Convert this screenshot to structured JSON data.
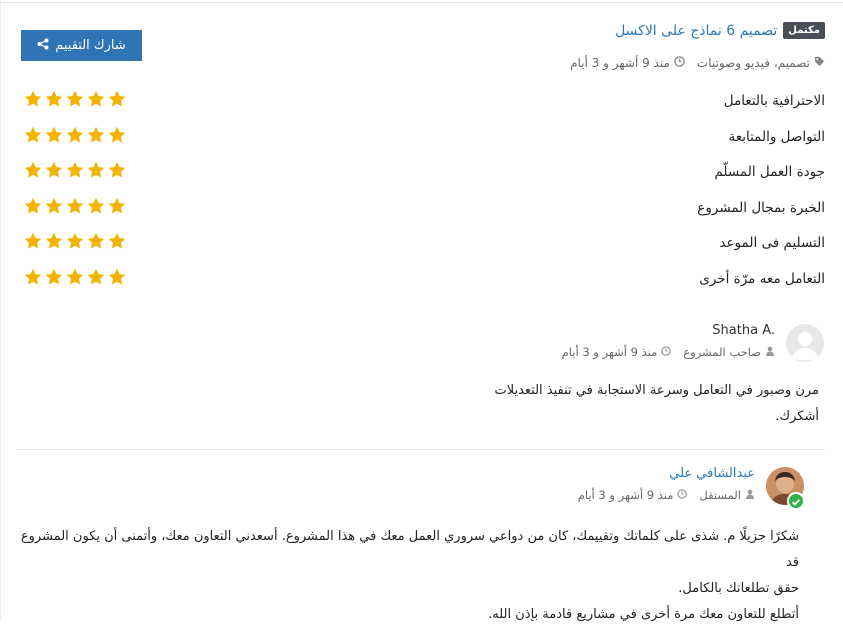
{
  "project": {
    "badge": "مكتمل",
    "title": "تصميم 6 نماذج على الاكسل",
    "category": "تصميم، فيديو وصوتيات",
    "time": "منذ 9 أشهر و 3 أيام"
  },
  "share": {
    "label": "شارك التقييم"
  },
  "criteria": [
    {
      "label": "الاحترافية بالتعامل",
      "rating": 5
    },
    {
      "label": "التواصل والمتابعة",
      "rating": 5
    },
    {
      "label": "جودة العمل المسلّم",
      "rating": 5
    },
    {
      "label": "الخبرة بمجال المشروع",
      "rating": 5
    },
    {
      "label": "التسليم فى الموعد",
      "rating": 5
    },
    {
      "label": "التعامل معه مرّة أخرى",
      "rating": 5
    }
  ],
  "review": {
    "name": "Shatha A.",
    "role": "صاحب المشروع",
    "time": "منذ 9 أشهر و 3 أيام",
    "lines": [
      "مرن وصبور في التعامل وسرعة الاستجابة في تنفيذ التعديلات",
      "أشكرك."
    ]
  },
  "reply": {
    "name": "عبدالشافي علي",
    "role": "المستقل",
    "time": "منذ 9 أشهر و 3 أيام",
    "lines": [
      "شكرًا جزيلًا م. شذى على كلماتك وتقييمك، كان من دواعي سروري العمل معك في هذا المشروع. أسعدني التعاون معك، وأتمنى أن يكون المشروع قد",
      "حقق تطلعاتك بالكامل.",
      "أتطلع للتعاون معك مرة أخرى في مشاريع قادمة بإذن الله."
    ]
  },
  "colors": {
    "accent": "#2b79b9",
    "button": "#2f74b5",
    "star": "#f5b301",
    "verified": "#2eb24a"
  },
  "icons": {
    "tag": "tag-icon",
    "clock": "clock-icon",
    "user": "user-icon",
    "share": "share-icon",
    "star": "star-icon"
  }
}
